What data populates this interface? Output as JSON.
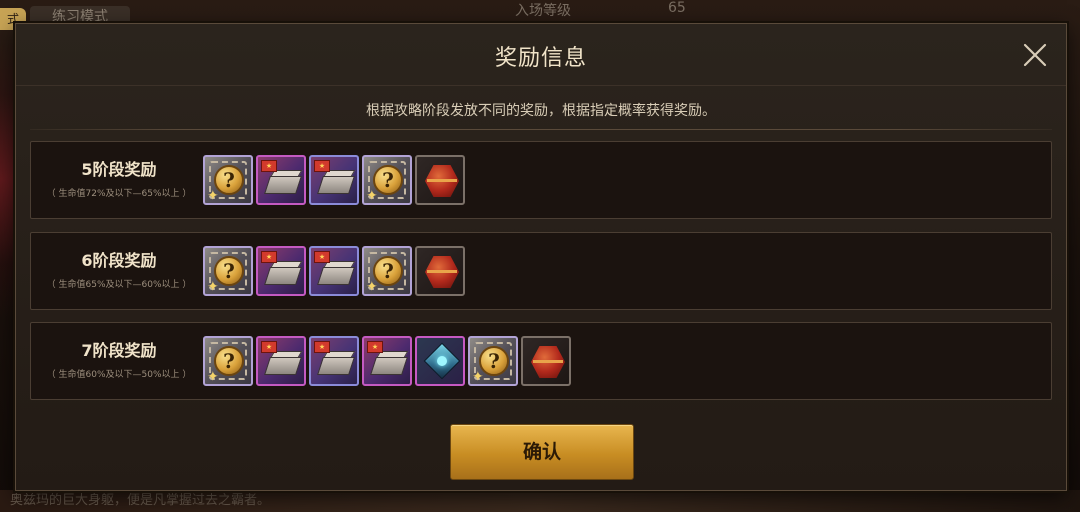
{
  "background": {
    "tab_marker": "式",
    "tab_label": "练习模式",
    "top_label": "入场等级",
    "top_value": "65",
    "footer_text": "奥兹玛的巨大身躯，便是凡掌握过去之霸者。"
  },
  "modal": {
    "title": "奖励信息",
    "close_icon": "close-x-icon",
    "description": "根据攻略阶段发放不同的奖励，根据指定概率获得奖励。",
    "confirm_label": "确认"
  },
  "stages": [
    {
      "title": "5阶段奖励",
      "condition": "（ 生命值72%及以下—65%以上 ）",
      "rewards": [
        "mystery-coin-icon",
        "supply-box-icon",
        "supply-box-icon",
        "mystery-coin-icon",
        "red-chest-icon"
      ]
    },
    {
      "title": "6阶段奖励",
      "condition": "（ 生命值65%及以下—60%以上 ）",
      "rewards": [
        "mystery-coin-icon",
        "supply-box-icon",
        "supply-box-icon",
        "mystery-coin-icon",
        "red-chest-icon"
      ]
    },
    {
      "title": "7阶段奖励",
      "condition": "（ 生命值60%及以下—50%以上 ）",
      "rewards": [
        "mystery-coin-icon",
        "supply-box-icon",
        "supply-box-icon",
        "supply-box-icon",
        "crystal-equipment-icon",
        "mystery-coin-icon",
        "red-chest-icon"
      ]
    }
  ],
  "colors": {
    "accent_gold": "#c88d23",
    "panel_bg": "#231b15",
    "row_bg": "#1b130f",
    "text_light": "#f0e3c9"
  }
}
